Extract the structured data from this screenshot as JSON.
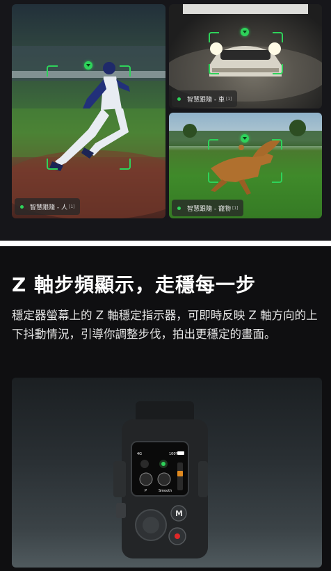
{
  "gallery": {
    "person_tag": {
      "label": "智慧跟隨 - 人",
      "note": "[1]"
    },
    "car_tag": {
      "label": "智慧跟隨 - 車",
      "note": "[1]"
    },
    "dog_tag": {
      "label": "智慧跟隨 - 寵物",
      "note": "[1]"
    },
    "accent_color": "#2ed35a"
  },
  "feature": {
    "heading": "Z 軸步頻顯示，走穩每一步",
    "description": "穩定器螢幕上的 Z 軸穩定指示器，可即時反映 Z 軸方向的上下抖動情況，引導你調整步伐，拍出更穩定的畫面。"
  },
  "device_screen": {
    "signal": "4G",
    "battery": "100%",
    "mode_p": "P",
    "mode_smooth": "Smooth",
    "m_button": "M"
  }
}
